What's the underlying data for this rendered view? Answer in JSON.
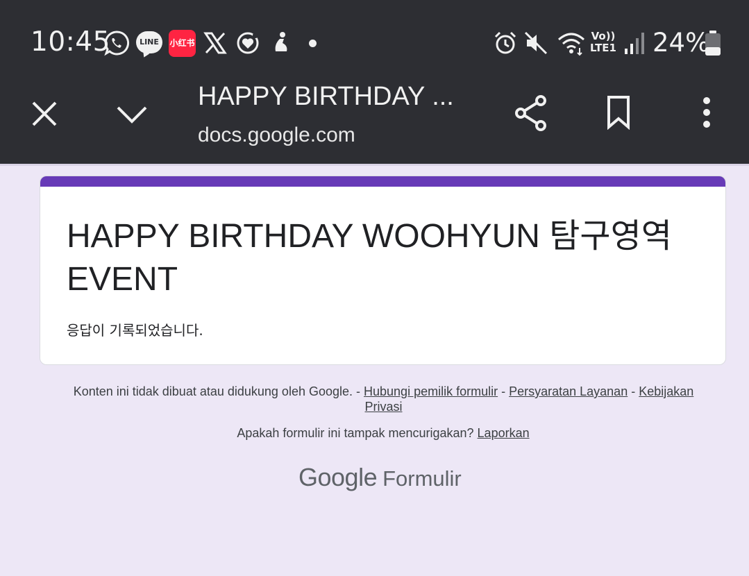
{
  "status_bar": {
    "time": "10:45",
    "line_label": "LINE",
    "xhs_label": "小红书",
    "network_lte": "Vo)) LTE1",
    "battery_percent": "24%",
    "notification_icons": [
      "whatsapp-icon",
      "line-icon",
      "xiaohongshu-icon",
      "x-icon",
      "heart-app-icon",
      "pilates-app-icon",
      "more-notifications-dot"
    ],
    "system_icons": [
      "alarm-icon",
      "mute-icon",
      "wifi-icon",
      "lte-icon",
      "signal-icon",
      "battery-icon"
    ]
  },
  "toolbar": {
    "title": "HAPPY BIRTHDAY ...",
    "url": "docs.google.com"
  },
  "form": {
    "title": "HAPPY BIRTHDAY WOOHYUN 탐구영역 EVENT",
    "confirmation": "응답이 기록되었습니다."
  },
  "footer": {
    "disclaimer_text": "Konten ini tidak dibuat atau didukung oleh Google. - ",
    "contact_link": "Hubungi pemilik formulir",
    "sep1": " - ",
    "terms_link": "Persyaratan Layanan",
    "sep2": " - ",
    "privacy_link": "Kebijakan Privasi",
    "suspicious_text": "Apakah formulir ini tampak mencurigakan? ",
    "report_link": "Laporkan",
    "brand_google": "Google",
    "brand_product": "Formulir"
  },
  "colors": {
    "header_bg": "#2d2e33",
    "page_bg": "#ede7f6",
    "accent": "#673ab7",
    "xhs_red": "#ff2442"
  }
}
